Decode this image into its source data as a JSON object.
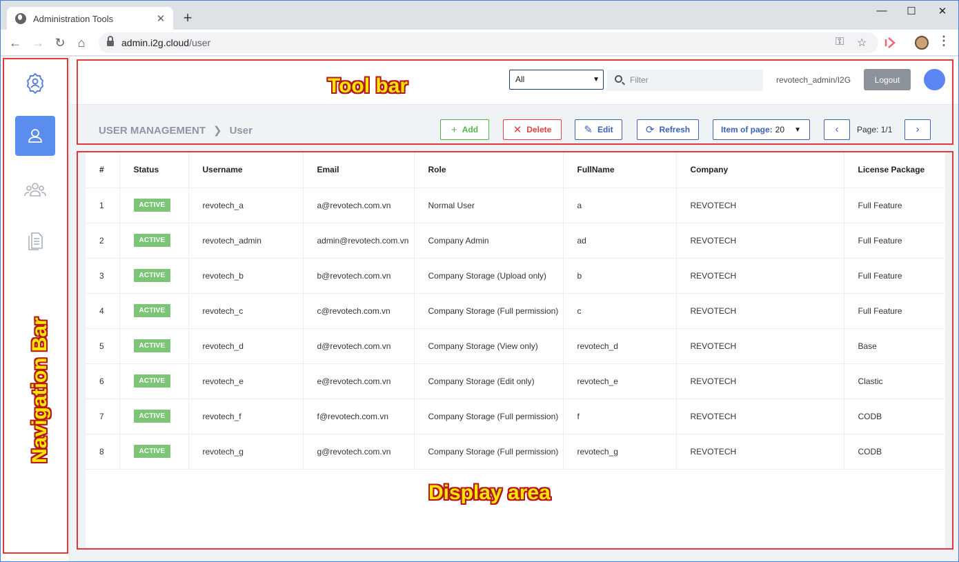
{
  "browser": {
    "tab_title": "Administration Tools",
    "url_host": "admin.i2g.cloud",
    "url_path": "/user"
  },
  "icons": {
    "back": "arrow-left",
    "forward": "arrow-right",
    "reload": "reload",
    "home": "home",
    "key": "key",
    "bookmark": "star",
    "settings_nav": "gear-user",
    "users_nav": "user",
    "groups_nav": "group",
    "docs_nav": "documents"
  },
  "toolbar": {
    "filter_select": "All",
    "filter_placeholder": "Filter",
    "user_label": "revotech_admin/I2G",
    "logout_label": "Logout"
  },
  "header": {
    "breadcrumb_root": "USER MANAGEMENT",
    "breadcrumb_current": "User",
    "add_label": "Add",
    "delete_label": "Delete",
    "edit_label": "Edit",
    "refresh_label": "Refresh",
    "items_per_page_label": "Item of page:",
    "items_per_page_value": "20",
    "page_label": "Page: 1/1"
  },
  "table": {
    "columns": [
      "#",
      "Status",
      "Username",
      "Email",
      "Role",
      "FullName",
      "Company",
      "License Package"
    ],
    "rows": [
      [
        "1",
        "ACTIVE",
        "revotech_a",
        "a@revotech.com.vn",
        "Normal User",
        "a",
        "REVOTECH",
        "Full Feature"
      ],
      [
        "2",
        "ACTIVE",
        "revotech_admin",
        "admin@revotech.com.vn",
        "Company Admin",
        "ad",
        "REVOTECH",
        "Full Feature"
      ],
      [
        "3",
        "ACTIVE",
        "revotech_b",
        "b@revotech.com.vn",
        "Company Storage (Upload only)",
        "b",
        "REVOTECH",
        "Full Feature"
      ],
      [
        "4",
        "ACTIVE",
        "revotech_c",
        "c@revotech.com.vn",
        "Company Storage (Full permission)",
        "c",
        "REVOTECH",
        "Full Feature"
      ],
      [
        "5",
        "ACTIVE",
        "revotech_d",
        "d@revotech.com.vn",
        "Company Storage (View only)",
        "revotech_d",
        "REVOTECH",
        "Base"
      ],
      [
        "6",
        "ACTIVE",
        "revotech_e",
        "e@revotech.com.vn",
        "Company Storage (Edit only)",
        "revotech_e",
        "REVOTECH",
        "Clastic"
      ],
      [
        "7",
        "ACTIVE",
        "revotech_f",
        "f@revotech.com.vn",
        "Company Storage (Full permission)",
        "f",
        "REVOTECH",
        "CODB"
      ],
      [
        "8",
        "ACTIVE",
        "revotech_g",
        "g@revotech.com.vn",
        "Company Storage (Full permission)",
        "revotech_g",
        "REVOTECH",
        "CODB"
      ]
    ]
  },
  "annotations": {
    "toolbar_label": "Tool bar",
    "navbar_label": "Navigation Bar",
    "display_label": "Display area"
  },
  "colors": {
    "accent": "#5b8def",
    "active_badge": "#7cc576",
    "annotation_border": "#e5363a",
    "annotation_text": "#ffe600"
  }
}
